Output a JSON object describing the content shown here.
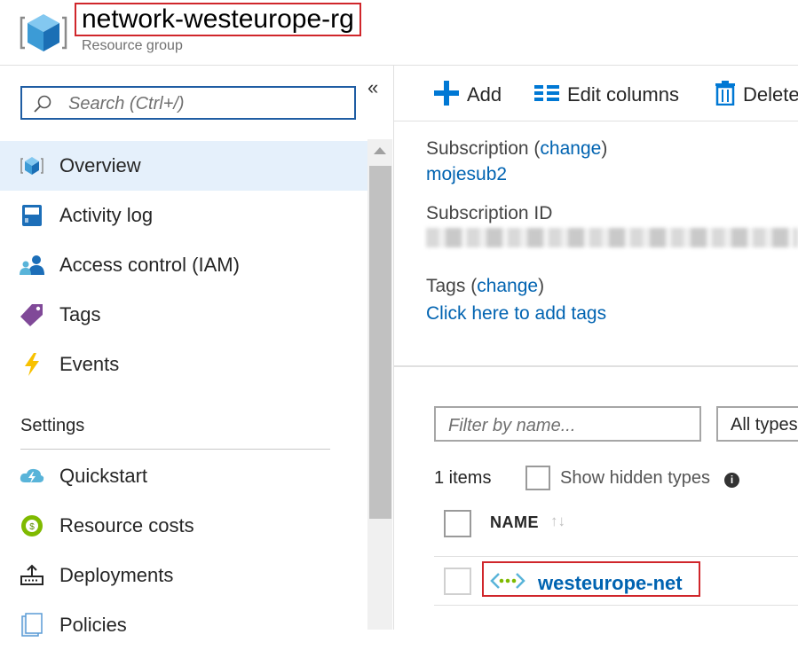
{
  "header": {
    "title": "network-westeurope-rg",
    "subtitle": "Resource group",
    "icon": "resource-group-cube-icon"
  },
  "sidebar": {
    "search": {
      "placeholder": "Search (Ctrl+/)",
      "value": ""
    },
    "collapse_glyph": "«",
    "items": [
      {
        "label": "Overview",
        "icon": "overview-cube-icon",
        "active": true
      },
      {
        "label": "Activity log",
        "icon": "activity-log-icon"
      },
      {
        "label": "Access control (IAM)",
        "icon": "iam-people-icon"
      },
      {
        "label": "Tags",
        "icon": "tag-icon"
      },
      {
        "label": "Events",
        "icon": "lightning-icon"
      }
    ],
    "settings_heading": "Settings",
    "settings_items": [
      {
        "label": "Quickstart",
        "icon": "cloud-lightning-icon"
      },
      {
        "label": "Resource costs",
        "icon": "cost-coin-icon"
      },
      {
        "label": "Deployments",
        "icon": "deployments-upload-icon"
      },
      {
        "label": "Policies",
        "icon": "policies-document-icon"
      }
    ]
  },
  "toolbar": {
    "add": "Add",
    "edit_columns": "Edit columns",
    "delete": "Delete"
  },
  "essentials": {
    "subscription_label": "Subscription",
    "change_link": "change",
    "subscription_value": "mojesub2",
    "subscription_id_label": "Subscription ID",
    "tags_label": "Tags",
    "tags_link": "Click here to add tags"
  },
  "resources": {
    "filter_placeholder": "Filter by name...",
    "types_value": "All types",
    "items_count": "1 items",
    "show_hidden_label": "Show hidden types",
    "column_name": "NAME",
    "rows": [
      {
        "name": "westeurope-net",
        "icon": "virtual-network-icon"
      }
    ]
  },
  "colors": {
    "accent": "#0078d4",
    "link": "#0063b1",
    "highlight_border": "#d0262b",
    "active_nav_bg": "#e5f0fb"
  }
}
